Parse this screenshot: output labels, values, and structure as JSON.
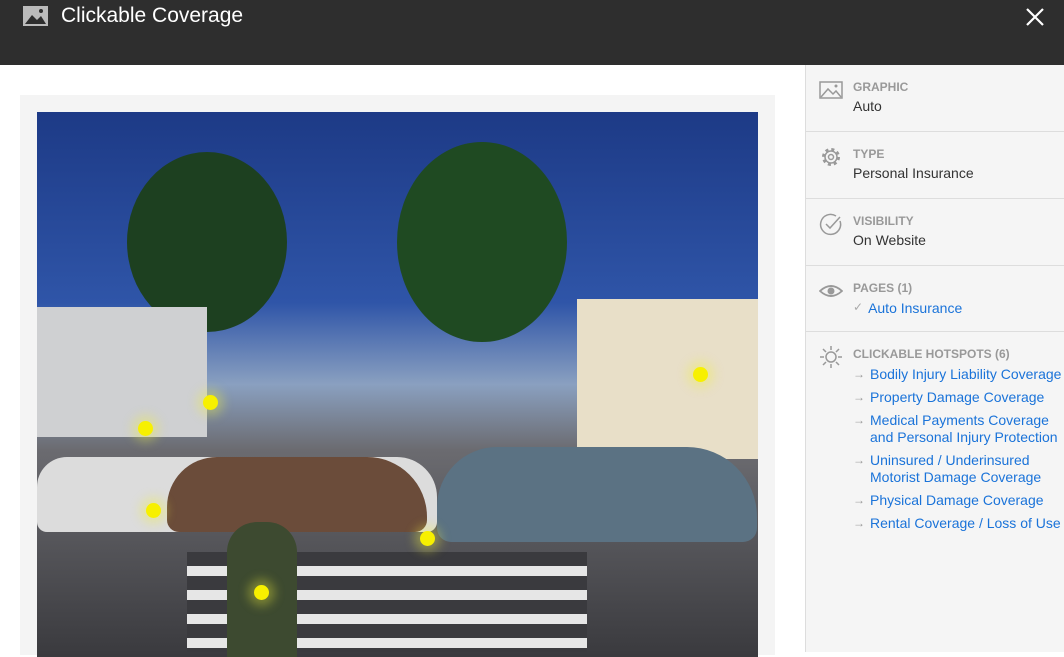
{
  "header": {
    "title": "Clickable Coverage"
  },
  "graphic": {
    "label": "GRAPHIC",
    "value": "Auto"
  },
  "type": {
    "label": "TYPE",
    "value": "Personal Insurance"
  },
  "visibility": {
    "label": "VISIBILITY",
    "value": "On Website"
  },
  "pages": {
    "label": "PAGES (1)",
    "items": [
      "Auto Insurance"
    ]
  },
  "hotspots": {
    "label": "CLICKABLE HOTSPOTS (6)",
    "items": [
      "Bodily Injury Liability Coverage",
      "Property Damage Coverage",
      "Medical Payments Coverage and Personal Injury Protection",
      "Uninsured / Underinsured Motorist Damage Coverage",
      "Physical Damage Coverage",
      "Rental Coverage / Loss of Use"
    ]
  },
  "colors": {
    "header": "#2e2e2e",
    "link": "#1a73d9",
    "hotspot": "#f7f000"
  }
}
